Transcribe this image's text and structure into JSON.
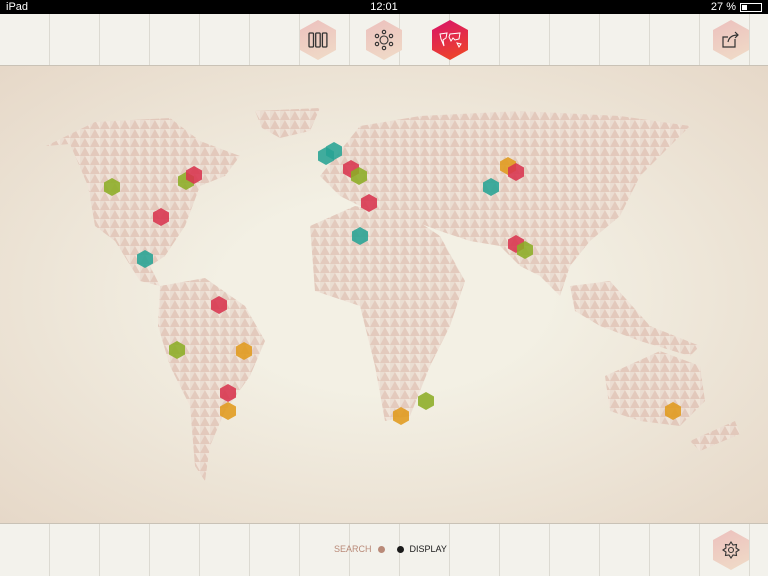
{
  "status": {
    "device": "iPad",
    "time": "12:01",
    "battery": "27 %"
  },
  "toolbar": {
    "buttons": [
      {
        "name": "columns-view",
        "active": false
      },
      {
        "name": "network-view",
        "active": false
      },
      {
        "name": "map-view",
        "active": true
      },
      {
        "name": "share",
        "active": false
      }
    ]
  },
  "legend": {
    "search": "SEARCH",
    "display": "DISPLAY",
    "search_color": "#b98a78",
    "display_color": "#1a1a1a"
  },
  "markers": {
    "colors": {
      "red": "#d8344f",
      "green": "#8cad25",
      "teal": "#27a394",
      "orange": "#e09a1c"
    }
  }
}
